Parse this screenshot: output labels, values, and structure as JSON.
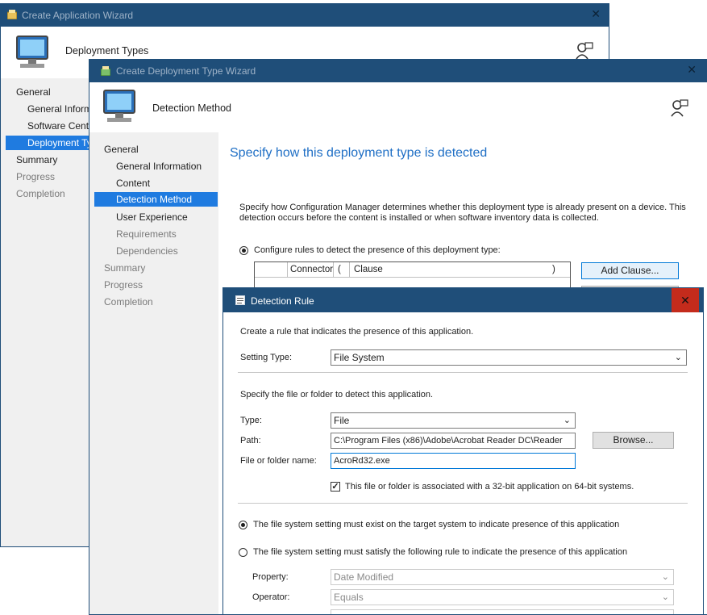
{
  "app_wizard": {
    "title": "Create Application Wizard",
    "header": "Deployment Types",
    "nav": [
      "General",
      "General Inform",
      "Software Cente",
      "Deployment Ty",
      "Summary",
      "Progress",
      "Completion"
    ]
  },
  "dt_wizard": {
    "title": "Create Deployment Type Wizard",
    "header": "Detection Method",
    "nav": [
      "General",
      "General Information",
      "Content",
      "Detection Method",
      "User Experience",
      "Requirements",
      "Dependencies",
      "Summary",
      "Progress",
      "Completion"
    ],
    "heading": "Specify how this deployment type is detected",
    "description_line1": "Specify how Configuration Manager determines whether this deployment type is already present on a device. This",
    "description_line2": "detection occurs before the content is installed or when software inventory data is collected.",
    "radio_rules_label": "Configure rules to detect the presence of this deployment type:",
    "grid_headers": [
      "Connector",
      "(",
      "Clause",
      ")"
    ],
    "add_clause_label": "Add Clause..."
  },
  "detection_rule": {
    "title": "Detection Rule",
    "close_glyph": "✕",
    "intro": "Create a rule that indicates the presence of this application.",
    "setting_type_label": "Setting Type:",
    "setting_type_value": "File System",
    "file_intro": "Specify the file or folder to detect this application.",
    "type_label": "Type:",
    "type_value": "File",
    "path_label": "Path:",
    "path_value": "C:\\Program Files (x86)\\Adobe\\Acrobat Reader DC\\Reader",
    "browse_label": "Browse...",
    "name_label": "File or folder name:",
    "name_value": "AcroRd32.exe",
    "checkbox_label": "This file or folder is associated with a 32-bit application on 64-bit systems.",
    "checkbox_checked": true,
    "radio_exist_label": "The file system setting must exist on the target system to indicate presence of this application",
    "radio_rule_label": "The file system setting must satisfy the following rule to indicate the presence of this application",
    "property_label": "Property:",
    "property_value": "Date Modified",
    "operator_label": "Operator:",
    "operator_value": "Equals"
  },
  "colors": {
    "titlebar": "#1f4e79",
    "selection": "#1f7be0",
    "heading": "#1f6fc5",
    "close_button": "#c42b1c"
  },
  "icons": [
    "computer-icon",
    "help-person-icon",
    "wizard-icon",
    "close-icon",
    "chevron-down-icon",
    "rule-window-icon"
  ]
}
